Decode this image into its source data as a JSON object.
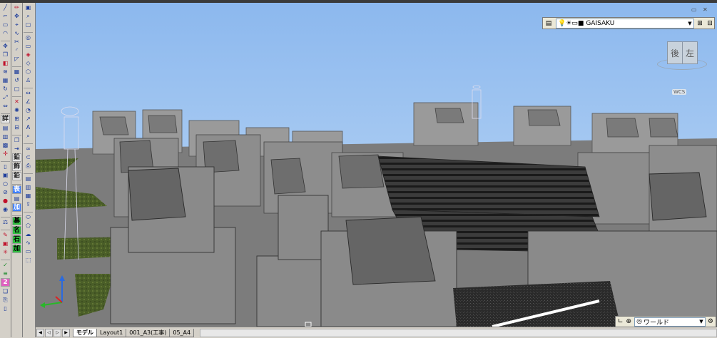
{
  "layer_toolbar": {
    "layer_name": "GAISAKU"
  },
  "viewcube": {
    "face_back": "後",
    "face_left": "左",
    "wcs_label": "WCS"
  },
  "ucs": {
    "value": "ワールド"
  },
  "left_toolbar_kanji": [
    "詳",
    "鉛",
    "飾",
    "鉛",
    "表",
    "加",
    "碁",
    "名",
    "石",
    "加"
  ],
  "tabs": {
    "model": "モデル",
    "layout1": "Layout1",
    "sheet1": "001_A3(工事)",
    "sheet2": "05_A4"
  },
  "colors": {
    "sky": "#a6c8f0",
    "stone": "#8a8a8a",
    "grass": "#4a6a2a"
  }
}
